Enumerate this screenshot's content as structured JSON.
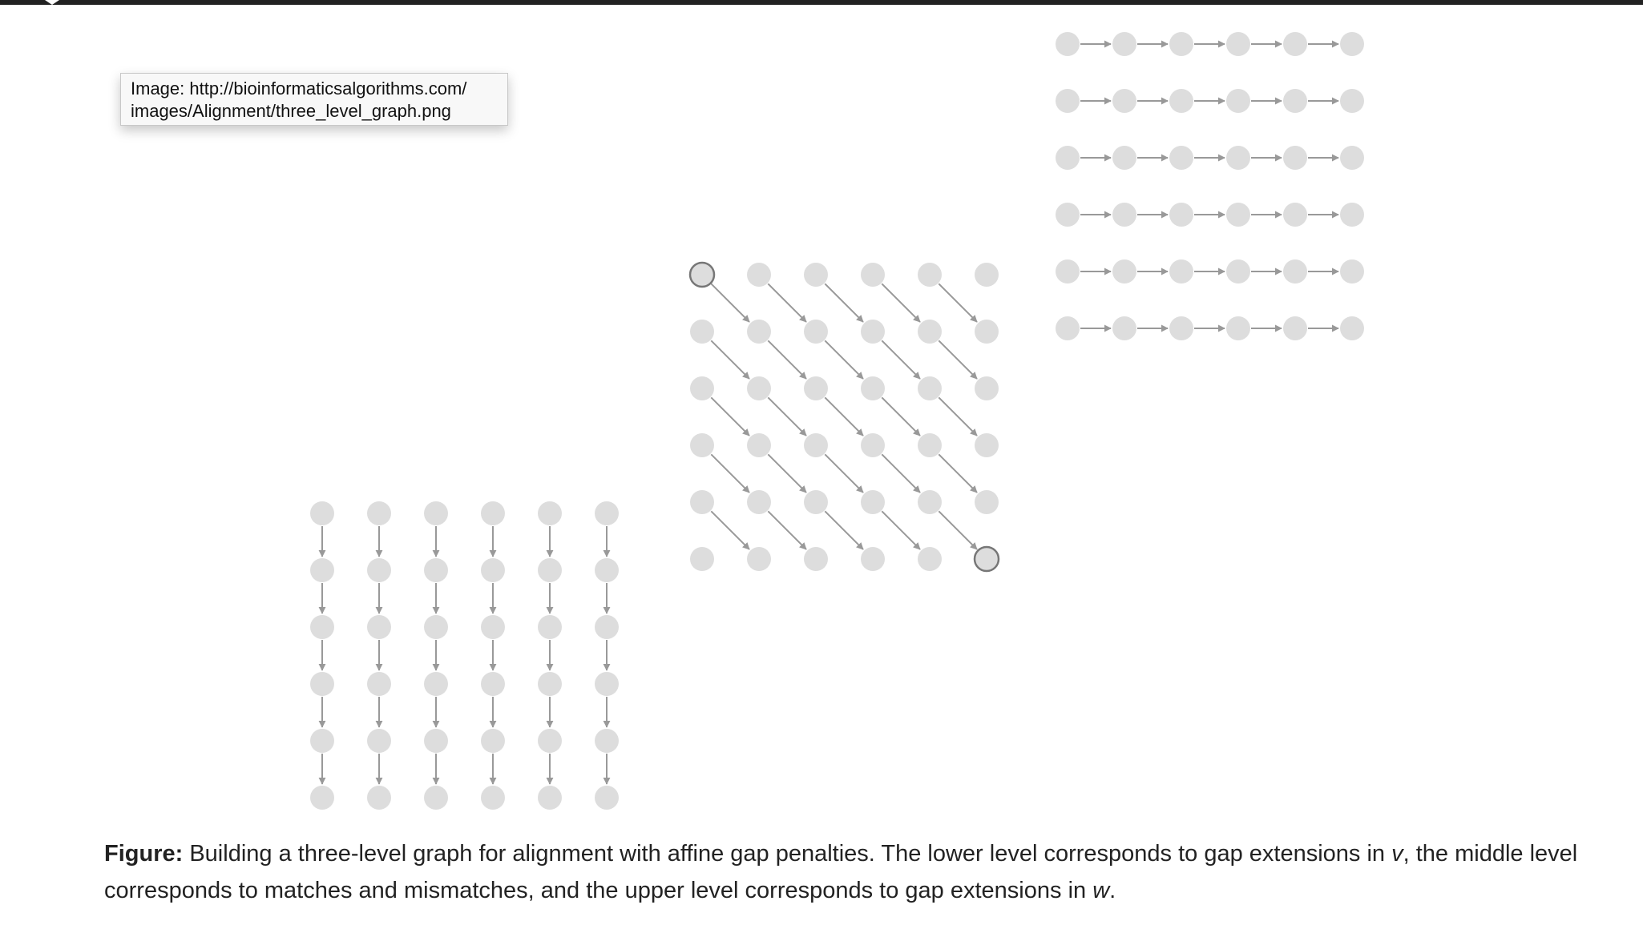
{
  "tooltip": {
    "line1": "Image: http://bioinformaticsalgorithms.com/",
    "line2": "images/Alignment/three_level_graph.png"
  },
  "figure": {
    "rows": 6,
    "cols": 6,
    "node_color": "#dddddd",
    "edge_color": "#999999",
    "endpoint_stroke": "#777777",
    "levels": [
      {
        "name": "lower",
        "edge_direction": "down"
      },
      {
        "name": "middle",
        "edge_direction": "diagonal"
      },
      {
        "name": "upper",
        "edge_direction": "right"
      }
    ]
  },
  "caption": {
    "label": "Figure:",
    "text_1": " Building a three-level graph for alignment with affine gap penalties. The lower level corresponds to gap extensions in ",
    "var_v": "v",
    "text_2": ", the middle level corresponds to matches and mismatches, and the upper level corresponds to gap extensions in ",
    "var_w": "w",
    "text_3": "."
  }
}
